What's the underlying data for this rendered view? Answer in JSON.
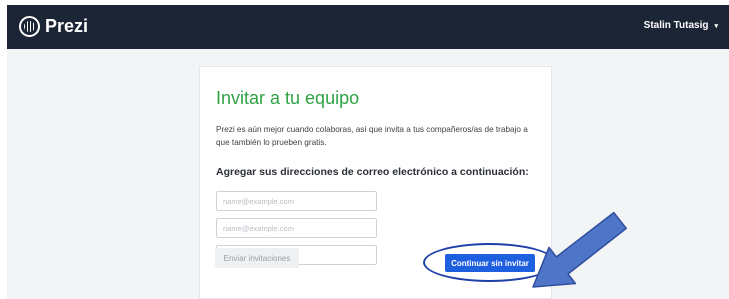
{
  "header": {
    "logo_text": "Prezi",
    "user_name": "Stalin Tutasig",
    "caret": "▾"
  },
  "card": {
    "title": "Invitar a tu equipo",
    "description": "Prezi es aún mejor cuando colaboras, así que invita a tus compañeros/as de trabajo a que también lo prueben gratis.",
    "subtitle": "Agregar sus direcciones de correo electrónico a continuación:",
    "email_inputs": [
      {
        "placeholder": "name@example.com",
        "value": ""
      },
      {
        "placeholder": "name@example.com",
        "value": ""
      },
      {
        "placeholder": "name@example.com",
        "value": ""
      }
    ],
    "send_button_label": "Enviar invitaciones",
    "continue_button_label": "Continuar sin invitar"
  },
  "annotation": {
    "arrow_color": "#4f75c9",
    "ellipse_color": "#1f3fa8"
  },
  "colors": {
    "topbar": "#1c2536",
    "title_green": "#2fa344",
    "primary_blue": "#1e5fe0",
    "background": "#f3f4f6"
  }
}
